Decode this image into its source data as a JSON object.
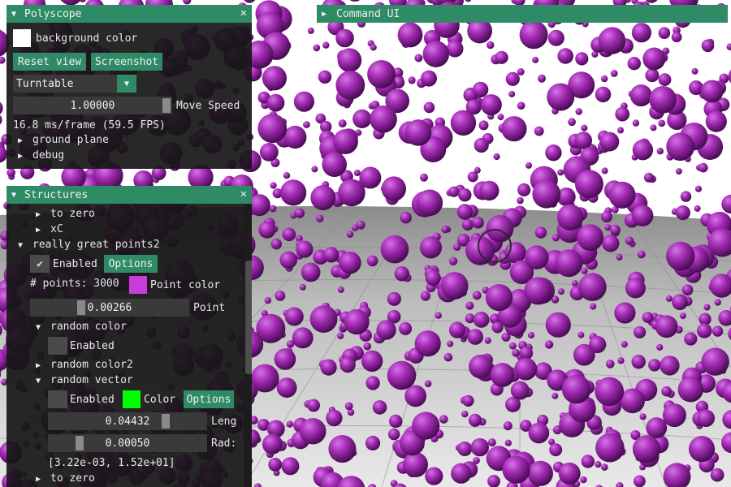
{
  "colors": {
    "accent": "#2e8b66",
    "panel_bg": "#161616",
    "point_color": "#c83cdc",
    "vector_color": "#00ff00",
    "background_color": "#ffffff"
  },
  "polyscope": {
    "title": "Polyscope",
    "background_color_label": "background color",
    "reset_view": "Reset view",
    "screenshot": "Screenshot",
    "view_mode": "Turntable",
    "move_speed_value": "1.00000",
    "move_speed_label": "Move Speed",
    "fps": "16.8 ms/frame (59.5 FPS)",
    "ground_plane": "ground plane",
    "debug": "debug"
  },
  "command_ui": {
    "title": "Command UI"
  },
  "structures": {
    "title": "Structures",
    "to_zero_top": "to zero",
    "xc": "xC",
    "group": "really great points2",
    "enabled": "Enabled",
    "options": "Options",
    "num_points": "# points: 3000",
    "point_color": "Point color",
    "point_radius_value": "0.00266",
    "point_radius_label": "Point",
    "random_color": "random color",
    "random_color_enabled": "Enabled",
    "random_color2": "random color2",
    "random_vector": "random vector",
    "rv_enabled": "Enabled",
    "rv_color": "Color",
    "rv_options": "Options",
    "length_value": "0.04432",
    "length_label": "Leng",
    "radius_value": "0.00050",
    "radius_label": "Rad:",
    "range": "[3.22e-03, 1.52e+01]",
    "to_zero_bottom": "to zero"
  }
}
